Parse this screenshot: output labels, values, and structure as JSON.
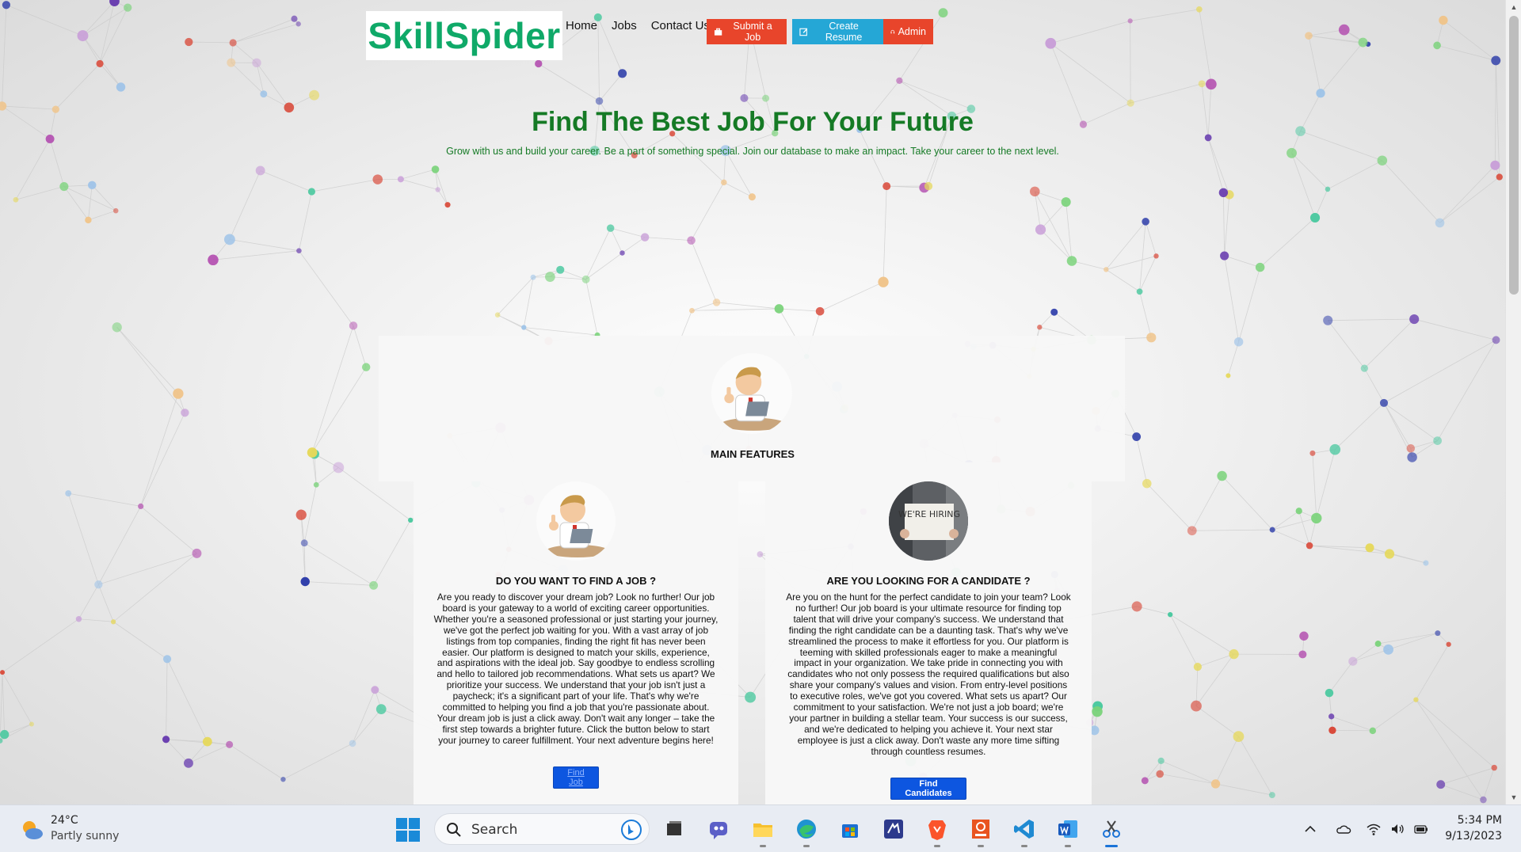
{
  "site": {
    "logo": "SkillSpider",
    "nav": [
      "Home",
      "Jobs",
      "Contact Us"
    ],
    "buttons": {
      "submit_job": "Submit a Job",
      "create_resume": "Create Resume",
      "admin": "Admin"
    }
  },
  "hero": {
    "title": "Find The Best Job For Your Future",
    "subtitle": "Grow with us and build your career. Be a part of something special. Join our database to make an impact. Take your career to the next level."
  },
  "features": {
    "title": "MAIN FEATURES",
    "job_seeker": {
      "title": "DO YOU WANT TO FIND A JOB ?",
      "body": "Are you ready to discover your dream job? Look no further! Our job board is your gateway to a world of exciting career opportunities. Whether you're a seasoned professional or just starting your journey, we've got the perfect job waiting for you. With a vast array of job listings from top companies, finding the right fit has never been easier. Our platform is designed to match your skills, experience, and aspirations with the ideal job. Say goodbye to endless scrolling and hello to tailored job recommendations. What sets us apart? We prioritize your success. We understand that your job isn't just a paycheck; it's a significant part of your life. That's why we're committed to helping you find a job that you're passionate about. Your dream job is just a click away. Don't wait any longer – take the first step towards a brighter future. Click the button below to start your journey to career fulfillment. Your next adventure begins here!",
      "button": "Find Job"
    },
    "employer": {
      "title": "ARE YOU LOOKING FOR A CANDIDATE ?",
      "body": "Are you on the hunt for the perfect candidate to join your team? Look no further! Our job board is your ultimate resource for finding top talent that will drive your company's success. We understand that finding the right candidate can be a daunting task. That's why we've streamlined the process to make it effortless for you. Our platform is teeming with skilled professionals eager to make a meaningful impact in your organization. We take pride in connecting you with candidates who not only possess the required qualifications but also share your company's values and vision. From entry-level positions to executive roles, we've got you covered. What sets us apart? Our commitment to your satisfaction. We're not just a job board; we're your partner in building a stellar team. Your success is our success, and we're dedicated to helping you achieve it. Your next star employee is just a click away. Don't waste any more time sifting through countless resumes.",
      "button": "Find Candidates",
      "image_sign": "WE'RE HIRING"
    }
  },
  "taskbar": {
    "weather": {
      "temp": "24°C",
      "desc": "Partly sunny"
    },
    "search_placeholder": "Search",
    "apps": [
      "start-icon",
      "search",
      "task-view-icon",
      "teams-icon",
      "file-explorer-icon",
      "edge-icon",
      "store-icon",
      "vs-icon",
      "brave-icon",
      "ubuntu-icon",
      "vscode-icon",
      "word-icon",
      "snipping-tool-icon"
    ],
    "clock": {
      "time": "5:34 PM",
      "date": "9/13/2023"
    }
  },
  "colors": {
    "brand_green": "#0fa968",
    "hero_green": "#157a25",
    "btn_red": "#e8452b",
    "btn_blue": "#25a7d6",
    "cta_blue": "#0d56e0"
  }
}
